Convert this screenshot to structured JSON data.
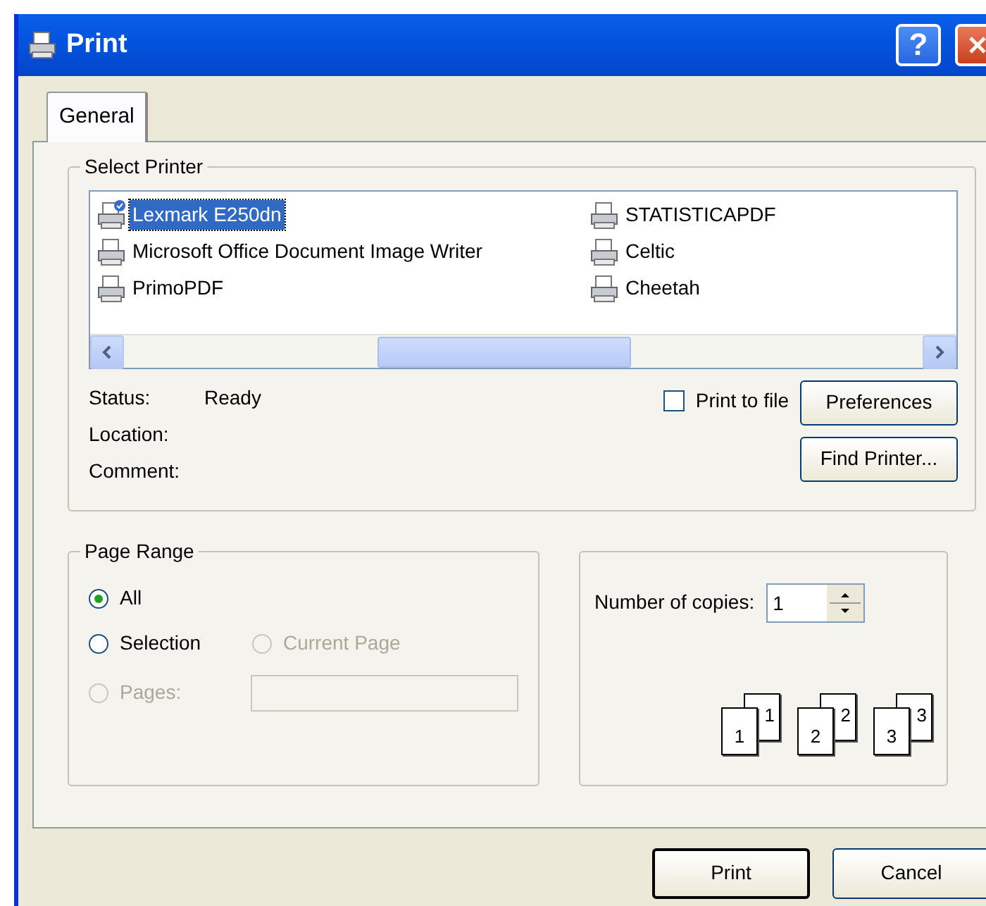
{
  "window": {
    "title": "Print",
    "help_label": "?"
  },
  "tabs": [
    {
      "label": "General",
      "selected": true
    }
  ],
  "select_printer": {
    "title": "Select Printer",
    "printers": [
      {
        "name": "Lexmark E250dn",
        "selected": true,
        "default": true
      },
      {
        "name": "Microsoft Office Document Image Writer",
        "selected": false,
        "default": false
      },
      {
        "name": "PrimoPDF",
        "selected": false,
        "default": false
      },
      {
        "name": "STATISTICAPDF",
        "selected": false,
        "default": false
      },
      {
        "name": "Celtic",
        "selected": false,
        "default": false
      },
      {
        "name": "Cheetah",
        "selected": false,
        "default": false
      }
    ],
    "info": [
      {
        "label": "Status:",
        "value": "Ready"
      },
      {
        "label": "Location:"
      },
      {
        "label": "Comment:"
      }
    ],
    "print_to_file": {
      "label": "Print to file",
      "checked": false
    },
    "buttons": [
      "Preferences",
      "Find Printer..."
    ]
  },
  "page_range": {
    "title": "Page Range",
    "options": [
      {
        "label": "All",
        "selected": true,
        "disabled": false
      },
      {
        "label": "Selection",
        "selected": false,
        "disabled": false
      },
      {
        "label": "Current Page",
        "selected": false,
        "disabled": true
      },
      {
        "label": "Pages:",
        "selected": false,
        "disabled": true
      }
    ],
    "pages_field": {
      "disabled": true
    }
  },
  "copies": {
    "label": "Number of copies:",
    "value": "1",
    "collate": [
      {
        "back": "1",
        "front": "1"
      },
      {
        "back": "2",
        "front": "2"
      },
      {
        "back": "3",
        "front": "3"
      }
    ]
  },
  "buttons": [
    {
      "label": "Print",
      "default": true
    },
    {
      "label": "Cancel",
      "default": false
    }
  ]
}
